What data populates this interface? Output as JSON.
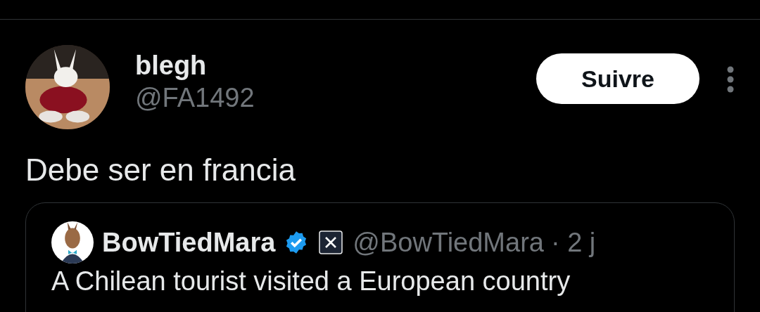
{
  "author": {
    "name": "blegh",
    "handle": "@FA1492"
  },
  "follow_button": {
    "label": "Suivre"
  },
  "tweet": {
    "text": "Debe ser en francia"
  },
  "quoted_tweet": {
    "author": {
      "name": "BowTiedMara",
      "verified": true,
      "handle": "@BowTiedMara"
    },
    "time": "· 2 j",
    "text": "A Chilean tourist visited a European country"
  }
}
